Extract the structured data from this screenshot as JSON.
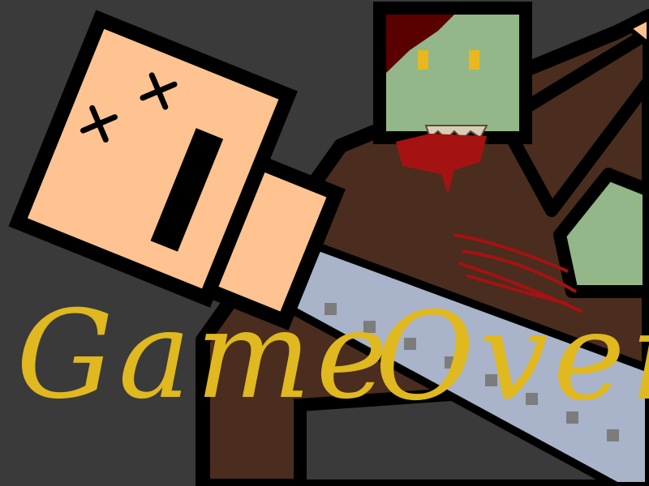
{
  "screen": {
    "title_word_1": "Game",
    "title_word_2": "Over"
  },
  "colors": {
    "background": "#3a3a3a",
    "title": "#e0b81f",
    "skin": "#ffc391",
    "zombie_skin": "#93b788",
    "zombie_hair": "#5a0000",
    "zombie_eyes": "#e8b81e",
    "blood": "#a51212",
    "wood": "#4a2d1e",
    "blade": "#a9b3c9",
    "blade_dots": "#7c7c7c",
    "outline": "#000000"
  },
  "icons": {
    "player": "dead-player-head-icon",
    "zombie": "zombie-head-icon",
    "weapon": "chainsaw-icon"
  }
}
